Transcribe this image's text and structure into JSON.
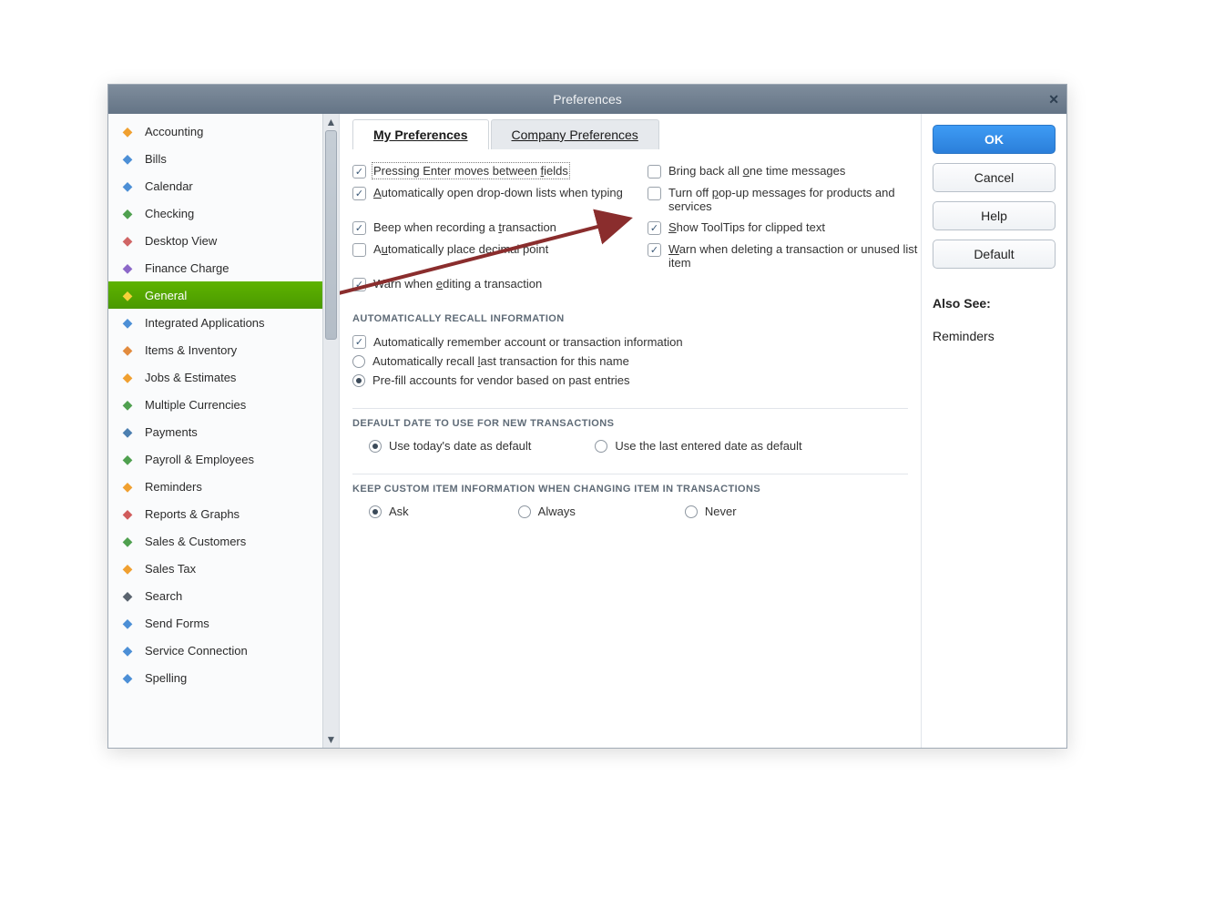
{
  "window": {
    "title": "Preferences"
  },
  "sidebar": {
    "items": [
      {
        "label": "Accounting",
        "icon_color": "#f0a030"
      },
      {
        "label": "Bills",
        "icon_color": "#4c8fd6"
      },
      {
        "label": "Calendar",
        "icon_color": "#4c8fd6"
      },
      {
        "label": "Checking",
        "icon_color": "#4fa04f"
      },
      {
        "label": "Desktop View",
        "icon_color": "#d06565"
      },
      {
        "label": "Finance Charge",
        "icon_color": "#8c68c8"
      },
      {
        "label": "General",
        "icon_color": "#f6d13a",
        "active": true
      },
      {
        "label": "Integrated Applications",
        "icon_color": "#4c8fd6"
      },
      {
        "label": "Items & Inventory",
        "icon_color": "#e28b3e"
      },
      {
        "label": "Jobs & Estimates",
        "icon_color": "#f0a030"
      },
      {
        "label": "Multiple Currencies",
        "icon_color": "#4fa04f"
      },
      {
        "label": "Payments",
        "icon_color": "#4c7fb0"
      },
      {
        "label": "Payroll & Employees",
        "icon_color": "#4fa04f"
      },
      {
        "label": "Reminders",
        "icon_color": "#f0a030"
      },
      {
        "label": "Reports & Graphs",
        "icon_color": "#d05c5c"
      },
      {
        "label": "Sales & Customers",
        "icon_color": "#4fa04f"
      },
      {
        "label": "Sales Tax",
        "icon_color": "#f0a030"
      },
      {
        "label": "Search",
        "icon_color": "#5a646f"
      },
      {
        "label": "Send Forms",
        "icon_color": "#4c8fd6"
      },
      {
        "label": "Service Connection",
        "icon_color": "#4c8fd6"
      },
      {
        "label": "Spelling",
        "icon_color": "#4c8fd6"
      }
    ]
  },
  "tabs": {
    "my": "My Preferences",
    "company": "Company Preferences"
  },
  "checks": {
    "enter_fields": {
      "label_html": "Pressing Enter moves between <u>f</u>ields",
      "checked": true,
      "focused": true
    },
    "onetime_msgs": {
      "label_html": "Bring back all <u>o</u>ne time messages",
      "checked": false
    },
    "autodrop": {
      "label_html": "<u>A</u>utomatically open drop-down lists when typing",
      "checked": true
    },
    "popup_off": {
      "label_html": "Turn off <u>p</u>op-up messages for products and services",
      "checked": false
    },
    "beep_record": {
      "label_html": "Beep when recording a <u>t</u>ransaction",
      "checked": true
    },
    "tooltips": {
      "label_html": "<u>S</u>how ToolTips for clipped text",
      "checked": true
    },
    "auto_decimal": {
      "label_html": "A<u>u</u>tomatically place decimal point",
      "checked": false
    },
    "warn_delete": {
      "label_html": "<u>W</u>arn when deleting a transaction or unused list item",
      "checked": true
    },
    "warn_edit": {
      "label_html": "Warn when <u>e</u>diting a transaction",
      "checked": true
    }
  },
  "recall": {
    "heading": "AUTOMATICALLY RECALL INFORMATION",
    "auto_remember": {
      "label_html": "Automatically remember account or transaction information",
      "checked": true
    },
    "r1": {
      "label_html": "Automatically recall <u>l</u>ast transaction for this name",
      "selected": false
    },
    "r2": {
      "label_html": "Pre-fill accounts for vendor based on past entries",
      "selected": true
    }
  },
  "default_date": {
    "heading": "DEFAULT DATE TO USE FOR NEW TRANSACTIONS",
    "today": {
      "label": "Use today's date as default",
      "selected": true
    },
    "last": {
      "label": "Use the last entered date as default",
      "selected": false
    }
  },
  "keep_custom": {
    "heading": "KEEP CUSTOM ITEM INFORMATION WHEN CHANGING ITEM IN TRANSACTIONS",
    "ask": {
      "label": "Ask",
      "selected": true
    },
    "always": {
      "label": "Always",
      "selected": false
    },
    "never": {
      "label": "Never",
      "selected": false
    }
  },
  "buttons": {
    "ok": "OK",
    "cancel": "Cancel",
    "help": "Help",
    "default": "Default"
  },
  "also_see": {
    "heading": "Also See:",
    "link": "Reminders"
  }
}
